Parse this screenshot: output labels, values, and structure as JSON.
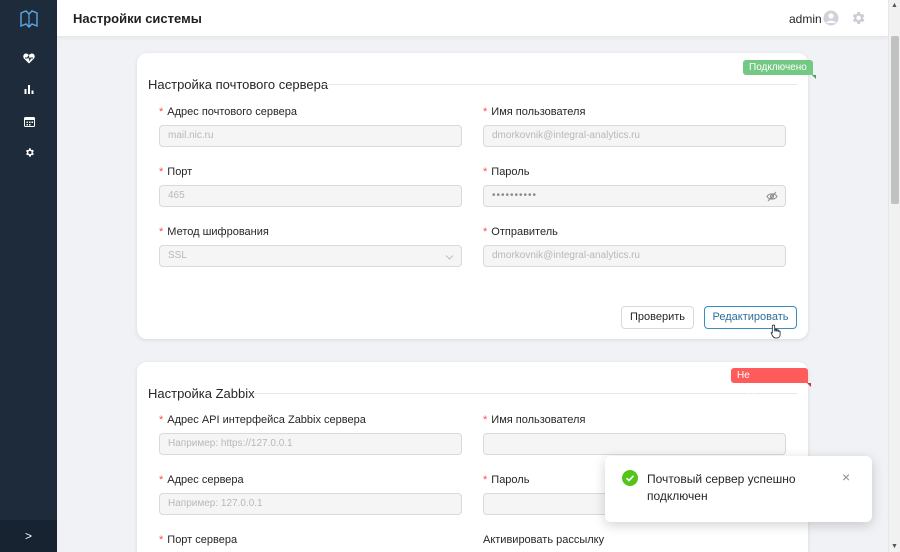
{
  "header": {
    "title": "Настройки системы",
    "user": "admin"
  },
  "sidebar": {
    "items": [
      {
        "icon": "heart-pulse-icon"
      },
      {
        "icon": "bar-chart-icon"
      },
      {
        "icon": "calendar-icon"
      },
      {
        "icon": "gear-icon"
      }
    ],
    "expand_label": ">"
  },
  "mail": {
    "title": "Настройка почтового сервера",
    "status": "Подключено",
    "fields": {
      "host": {
        "label": "Адрес почтового сервера",
        "value": "mail.nic.ru"
      },
      "username": {
        "label": "Имя пользователя",
        "value": "dmorkovnik@integral-analytics.ru"
      },
      "port": {
        "label": "Порт",
        "value": "465"
      },
      "password": {
        "label": "Пароль",
        "value": "••••••••••"
      },
      "encryption": {
        "label": "Метод шифрования",
        "value": "SSL"
      },
      "sender": {
        "label": "Отправитель",
        "value": "dmorkovnik@integral-analytics.ru"
      }
    },
    "check_label": "Проверить",
    "edit_label": "Редактировать"
  },
  "zabbix": {
    "title": "Настройка Zabbix",
    "status": "Не подключено",
    "fields": {
      "api": {
        "label": "Адрес API интерфейса Zabbix сервера",
        "placeholder": "Например: https://127.0.0.1"
      },
      "username": {
        "label": "Имя пользователя",
        "value": ""
      },
      "server": {
        "label": "Адрес сервера",
        "placeholder": "Например: 127.0.0.1"
      },
      "password": {
        "label": "Пароль",
        "value": ""
      },
      "port": {
        "label": "Порт сервера"
      },
      "mailing": {
        "label": "Активировать рассылку"
      }
    }
  },
  "toast": {
    "message": "Почтовый сервер успешно подключен",
    "close": "×"
  },
  "colors": {
    "sidebar": "#1e2b3a",
    "success": "#52c41a",
    "badge_ok": "#73c883",
    "badge_bad": "#ff5b5b",
    "accent": "#3a8ec4"
  }
}
